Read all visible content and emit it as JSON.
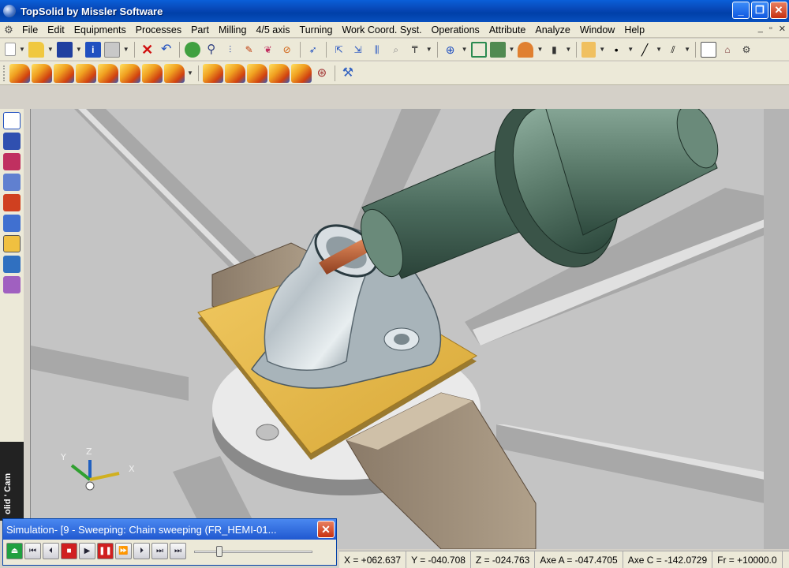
{
  "window": {
    "title": "TopSolid by Missler Software"
  },
  "menu": [
    "File",
    "Edit",
    "Equipments",
    "Processes",
    "Part",
    "Milling",
    "4/5 axis",
    "Turning",
    "Work Coord. Syst.",
    "Operations",
    "Attribute",
    "Analyze",
    "Window",
    "Help"
  ],
  "mdi_controls": [
    "_",
    "▫",
    "✕"
  ],
  "simulation": {
    "title": "Simulation- [9 - Sweeping: Chain sweeping    (FR_HEMI-01...",
    "progress_fraction": 0.2
  },
  "status": {
    "x": "X = +062.637",
    "y": "Y = -040.708",
    "z": "Z = -024.763",
    "axe_a": "Axe A = -047.4705",
    "axe_c": "Axe C = -142.0729",
    "fr": "Fr = +10000.0"
  },
  "branding": {
    "vertical_text": "olid ' Cam"
  },
  "axis_labels": {
    "x": "X",
    "y": "Y",
    "z": "Z"
  },
  "colors": {
    "titlebar": "#0848b8",
    "plate": "#e0b850",
    "spindle": "#4a7060",
    "tool": "#c06030",
    "part": "#c0c8cc"
  }
}
